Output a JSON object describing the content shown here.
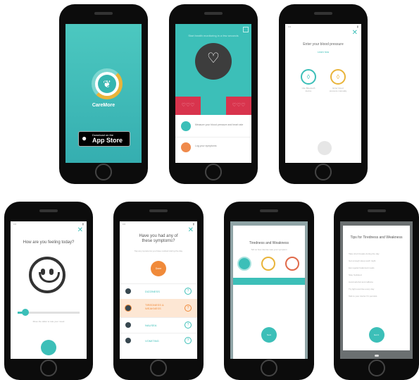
{
  "phone1": {
    "app_name": "CareMore",
    "store_badge": {
      "top": "Download on the",
      "main": "App Store"
    }
  },
  "phone2": {
    "header_text": "Start health monitoring in a few seconds",
    "list": [
      {
        "title": "Measure your blood pressure and heart rate"
      },
      {
        "title": "Log your symptoms"
      }
    ]
  },
  "phone3": {
    "title": "Enter your blood pressure",
    "link": "Learn how",
    "options": [
      {
        "label": "Use Bluetooth device"
      },
      {
        "label": "Enter blood pressure manually"
      }
    ]
  },
  "phone4": {
    "title": "How are you feeling today?",
    "hint": "Move the slider to rate your mood"
  },
  "phone5": {
    "title": "Have you had any of these symptoms?",
    "subtitle": "Tap any symptoms you have noticed during the day",
    "button": "Done",
    "symptoms": [
      "DIZZINESS",
      "TIREDNESS & WEAKNESS",
      "NAUSEA",
      "VOMITING"
    ]
  },
  "phone6": {
    "title": "Tiredness and Weakness",
    "subtitle": "Tell us how intense was your symptom",
    "button": "Next"
  },
  "phone7": {
    "title": "Tips for Tiredness and Weakness",
    "tips": [
      "Take short breaks during the day",
      "Get enough sleep each night",
      "Eat regular balanced meals",
      "Stay hydrated",
      "Avoid alcohol and caffeine",
      "Try light exercise every day",
      "Talk to your doctor if it persists"
    ],
    "button": "Got it"
  }
}
